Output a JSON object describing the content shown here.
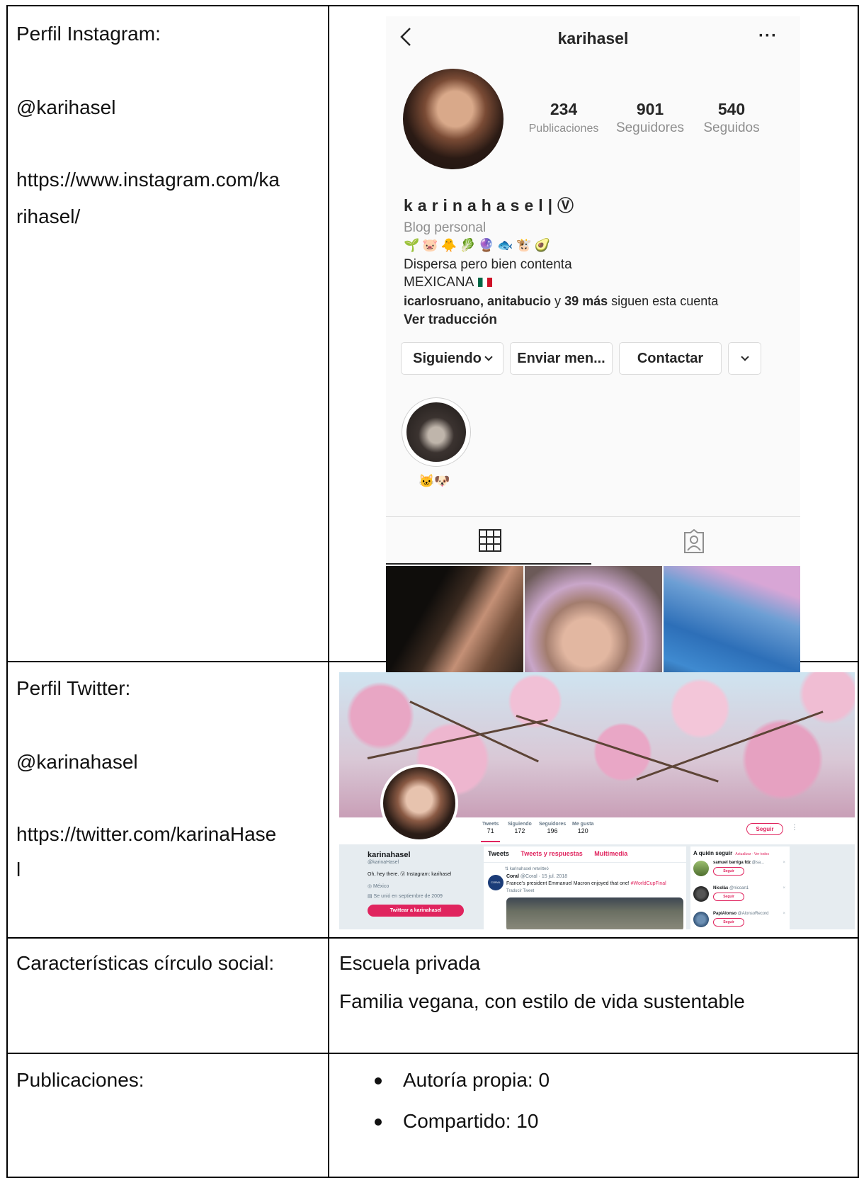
{
  "table": {
    "rows": [
      {
        "label": "Perfil Instagram:",
        "handle": "@karihasel",
        "url_line1": "https://www.instagram.com/ka",
        "url_line2": "rihasel/"
      },
      {
        "label": "Perfil Twitter:",
        "handle": "@karinahasel",
        "url_line1": "https://twitter.com/karinaHase",
        "url_line2": "l"
      },
      {
        "label": "Características círculo social:",
        "lines": [
          "Escuela privada",
          "Familia vegana, con estilo de vida sustentable"
        ]
      },
      {
        "label": "Publicaciones:",
        "bullets": [
          "Autoría propia: 0",
          "Compartido: 10"
        ]
      }
    ]
  },
  "instagram": {
    "username": "karihasel",
    "more": "···",
    "stats": [
      {
        "value": "234",
        "label": "Publicaciones"
      },
      {
        "value": "901",
        "label": "Seguidores"
      },
      {
        "value": "540",
        "label": "Seguidos"
      }
    ],
    "full_name": "karinahasel|Ⓥ",
    "category": "Blog personal",
    "emojis": "🌱🐷🐥🥬🔮🐟🐮🥑",
    "bio_line1": "Dispersa pero bien contenta",
    "bio_line2": "MEXICANA",
    "followed_by_names": "icarlosruano, anitabucio",
    "followed_by_y": " y ",
    "followed_by_count": "39 más",
    "followed_by_suffix": " siguen esta cuenta",
    "see_translation": "Ver traducción",
    "buttons": {
      "following": "Siguiendo",
      "message": "Enviar men...",
      "contact": "Contactar"
    },
    "highlight_label": "🐱🐶"
  },
  "twitter": {
    "stats": [
      {
        "label": "Tweets",
        "value": "71"
      },
      {
        "label": "Siguiendo",
        "value": "172"
      },
      {
        "label": "Seguidores",
        "value": "196"
      },
      {
        "label": "Me gusta",
        "value": "120"
      }
    ],
    "follow_button": "Seguir",
    "kebab": "⋮",
    "name": "karinahasel",
    "handle": "@karinaHasel",
    "bio": "Oh, hey there. Ⓥ Instagram: karihasel",
    "location": "◎ México",
    "joined": "▤ Se unió en septiembre de 2009",
    "tweet_to": "Twittear a karinahasel",
    "tabs": [
      "Tweets",
      "Tweets y respuestas",
      "Multimedia"
    ],
    "retweet_note": "⇅ karinahasel retwitteó",
    "coral_logo": "CORAL",
    "tweet_author": "Coral",
    "tweet_meta": " @Coral · 15 jul. 2018",
    "tweet_text": "France's president Emmanuel Macron enjoyed that one! ",
    "tweet_hashtag": "#WorldCupFinal",
    "tweet_translate": "Traducir Tweet",
    "who_to_follow": "A quién seguir",
    "who_to_follow_links": " · Actualizar · Ver todos",
    "suggestions": [
      {
        "name": "samuel barriga fdz",
        "handle": " @sa...",
        "button": "Seguir"
      },
      {
        "name": "Nicolás",
        "handle": " @nicoan1",
        "button": "Seguir"
      },
      {
        "name": "PapiAlonso",
        "handle": " @AlonsoRecord",
        "button": "Seguir"
      }
    ],
    "dismiss": "×"
  },
  "colors": {
    "twitter_accent": "#e0245e",
    "instagram_muted": "#8e8e8e"
  }
}
